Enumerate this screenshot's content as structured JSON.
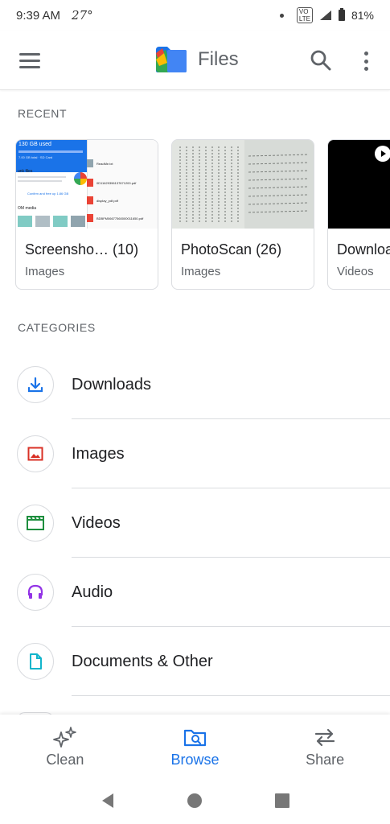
{
  "status_bar": {
    "time": "9:39 AM",
    "temperature": "27°",
    "battery": "81%"
  },
  "app_bar": {
    "title": "Files"
  },
  "recent": {
    "label": "RECENT",
    "cards": [
      {
        "title": "Screensho… (10)",
        "subtitle": "Images"
      },
      {
        "title": "PhotoScan (26)",
        "subtitle": "Images"
      },
      {
        "title": "Downloa",
        "subtitle": "Videos"
      }
    ]
  },
  "categories": {
    "label": "CATEGORIES",
    "items": [
      {
        "label": "Downloads",
        "icon": "download-icon",
        "color": "#1a73e8"
      },
      {
        "label": "Images",
        "icon": "image-icon",
        "color": "#d93025"
      },
      {
        "label": "Videos",
        "icon": "video-icon",
        "color": "#1e8e3e"
      },
      {
        "label": "Audio",
        "icon": "headphones-icon",
        "color": "#9334e6"
      },
      {
        "label": "Documents & Other",
        "icon": "document-icon",
        "color": "#12b5cb"
      }
    ]
  },
  "bottom_nav": {
    "items": [
      {
        "label": "Clean",
        "icon": "sparkle-icon",
        "active": false
      },
      {
        "label": "Browse",
        "icon": "browse-folder-icon",
        "active": true
      },
      {
        "label": "Share",
        "icon": "swap-arrows-icon",
        "active": false
      }
    ]
  },
  "thumb_text": {
    "storage_used": "130 GB used",
    "storage_total": "7.00 GB total · SD Card",
    "junk": "unk files",
    "confirm": "Confirm and free up 1.86 GB",
    "media": "OM media",
    "file1": "ReadMe.txt",
    "file2": "0D11629396137671200.pdf",
    "file3": "display_pdf.pdf",
    "file4": "BDBFM06677560000011650.pdf"
  },
  "colors": {
    "accent": "#1a73e8",
    "divider": "#dadce0",
    "text_secondary": "#5f6368"
  }
}
